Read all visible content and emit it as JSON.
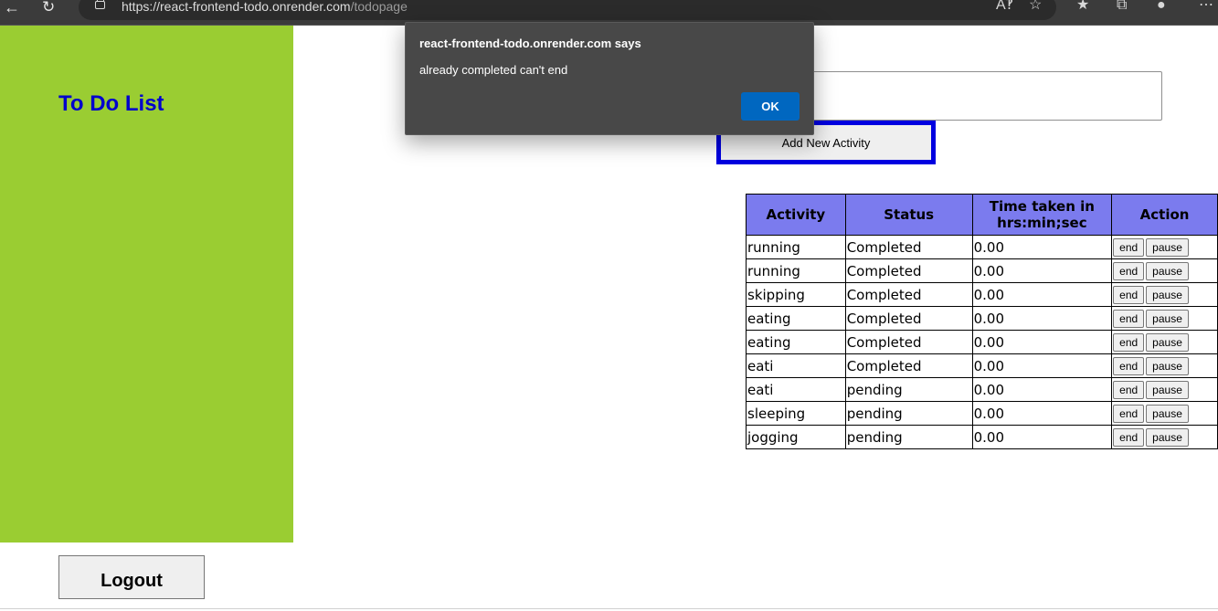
{
  "browser": {
    "url_host": "https://react-frontend-todo.onrender.com",
    "url_path": "/todopage",
    "icons": [
      "back-arrow-icon",
      "reload-icon",
      "lock-icon",
      "read-aloud-icon",
      "favorites-add-icon",
      "favorites-icon",
      "collections-icon",
      "profile-icon",
      "more-icon"
    ]
  },
  "sidebar": {
    "title": "To Do List",
    "logout_label": "Logout",
    "background": "#9acd32",
    "title_color": "#0000cd"
  },
  "main": {
    "input_value": "",
    "add_button_label": "Add New Activity",
    "add_button_border": "#0000e0"
  },
  "table": {
    "headers": [
      "Activity",
      "Status",
      "Time taken in hrs:min;sec",
      "Action"
    ],
    "header_color": "#7b7bee",
    "end_label": "end",
    "pause_label": "pause",
    "rows": [
      {
        "activity": "running",
        "status": "Completed",
        "time": "0.00"
      },
      {
        "activity": "running",
        "status": "Completed",
        "time": "0.00"
      },
      {
        "activity": "skipping",
        "status": "Completed",
        "time": "0.00"
      },
      {
        "activity": "eating",
        "status": "Completed",
        "time": "0.00"
      },
      {
        "activity": "eating",
        "status": "Completed",
        "time": "0.00"
      },
      {
        "activity": "eati",
        "status": "Completed",
        "time": "0.00"
      },
      {
        "activity": "eati",
        "status": "pending",
        "time": "0.00"
      },
      {
        "activity": "sleeping",
        "status": "pending",
        "time": "0.00"
      },
      {
        "activity": "jogging",
        "status": "pending",
        "time": "0.00"
      }
    ]
  },
  "dialog": {
    "title": "react-frontend-todo.onrender.com says",
    "message": "already completed can't end",
    "ok_label": "OK",
    "ok_color": "#0067c0"
  }
}
